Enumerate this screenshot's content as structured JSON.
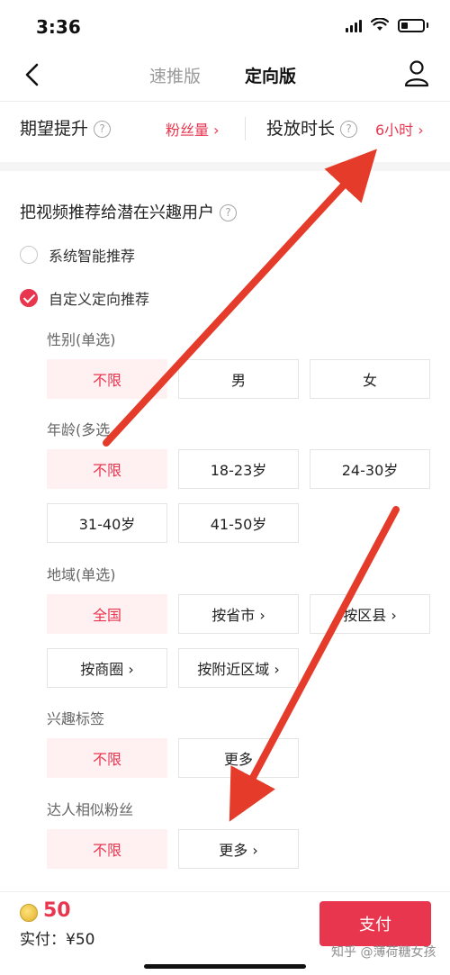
{
  "status_bar": {
    "time": "3:36"
  },
  "nav": {
    "tabs": [
      {
        "label": "速推版"
      },
      {
        "label": "定向版"
      }
    ]
  },
  "expect": {
    "label": "期望提升",
    "value": "粉丝量 ›",
    "duration_label": "投放时长",
    "duration_value": "6小时 ›"
  },
  "recommend": {
    "title": "把视频推荐给潜在兴趣用户",
    "options": [
      {
        "label": "系统智能推荐",
        "checked": false
      },
      {
        "label": "自定义定向推荐",
        "checked": true
      }
    ]
  },
  "gender": {
    "label": "性别(单选)",
    "options": [
      "不限",
      "男",
      "女"
    ],
    "selected": "不限"
  },
  "age": {
    "label": "年龄(多选",
    "options": [
      "不限",
      "18-23岁",
      "24-30岁",
      "31-40岁",
      "41-50岁"
    ],
    "selected": "不限"
  },
  "region": {
    "label": "地域(单选)",
    "options": [
      "全国",
      "按省市 ›",
      "按区县 ›",
      "按商圈 ›",
      "按附近区域 ›"
    ],
    "selected": "全国"
  },
  "interest": {
    "label": "兴趣标签",
    "options": [
      "不限",
      "更多"
    ],
    "selected": "不限"
  },
  "similar": {
    "label": "达人相似粉丝",
    "options": [
      "不限",
      "更多 ›"
    ],
    "selected": "不限"
  },
  "footer": {
    "coin_amount": "50",
    "paid_label": "实付：¥50",
    "pay_button": "支付",
    "watermark": "知乎 @薄荷糖女孩"
  },
  "colors": {
    "accent": "#e8364f",
    "selected_bg": "#fff0f2",
    "annotation_arrow": "#e53b2a"
  }
}
